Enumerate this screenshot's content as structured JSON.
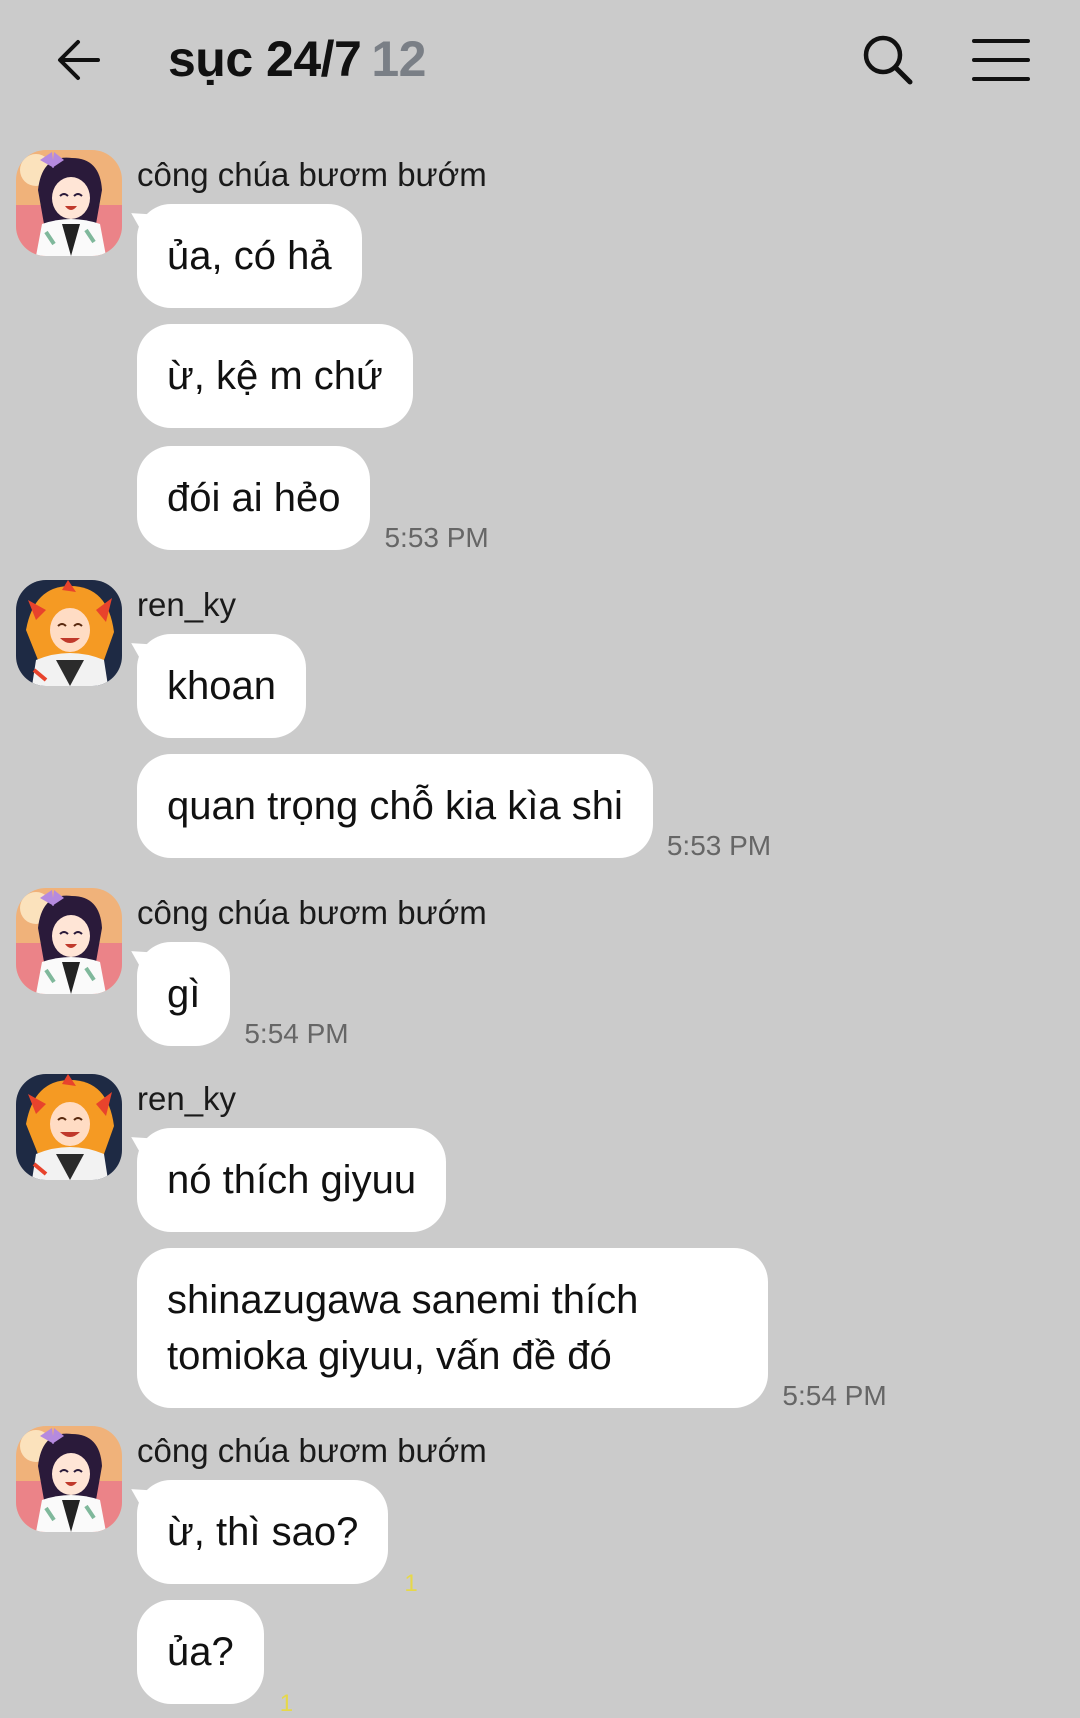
{
  "header": {
    "title": "sục 24/7",
    "member_count": "12"
  },
  "colors": {
    "background": "#cbcbcb",
    "bubble": "#ffffff",
    "unread": "#e6d84a"
  },
  "messages": [
    {
      "sender": "công chúa bươm bướm",
      "avatar": "shinobu-avatar",
      "lines": [
        "ủa, có hả",
        "ừ, kệ m chứ",
        "đói ai hẻo"
      ],
      "time": "5:53 PM"
    },
    {
      "sender": "ren_ky",
      "avatar": "rengoku-avatar",
      "lines": [
        "khoan",
        "quan trọng chỗ kia kìa shi"
      ],
      "time": "5:53 PM"
    },
    {
      "sender": "công chúa bươm bướm",
      "avatar": "shinobu-avatar",
      "lines": [
        "gì"
      ],
      "time": "5:54 PM"
    },
    {
      "sender": "ren_ky",
      "avatar": "rengoku-avatar",
      "lines": [
        "nó thích giyuu",
        "shinazugawa sanemi thích",
        "tomioka giyuu, vấn đề đó"
      ],
      "time": "5:54 PM"
    },
    {
      "sender": "công chúa bươm bướm",
      "avatar": "shinobu-avatar",
      "lines": [
        "ừ, thì sao?",
        "ủa?"
      ],
      "unread": [
        "1",
        "1"
      ]
    }
  ]
}
